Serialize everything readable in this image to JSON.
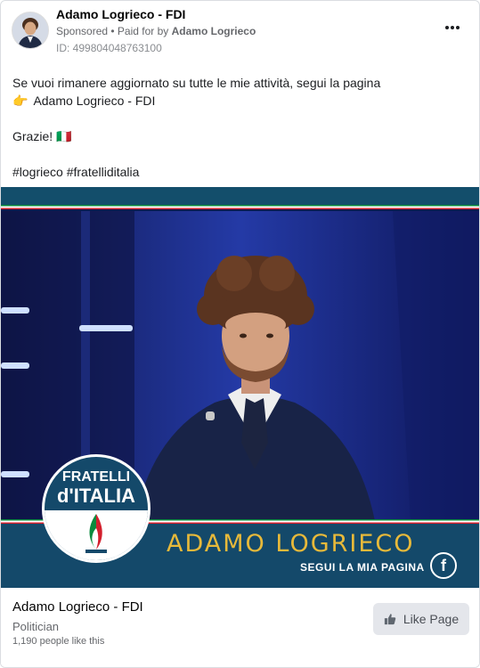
{
  "header": {
    "page_name": "Adamo Logrieco - FDI",
    "sponsored": "Sponsored",
    "paid_for_prefix": " • Paid for by ",
    "paid_by": "Adamo Logrieco",
    "ad_id": "ID: 499804048763100",
    "more_icon": "more-horizontal-icon"
  },
  "post": {
    "line1": "Se vuoi rimanere aggiornato su tutte le mie attività, segui la pagina",
    "line2_icon": "👉",
    "line2": "Adamo Logrieco - FDI",
    "thanks": "Grazie! 🇮🇹",
    "hashtags": "#logrieco #fratelliditalia"
  },
  "creative": {
    "logo_line1": "FRATELLI",
    "logo_line2": "d'ITALIA",
    "name": "ADAMO LOGRIECO",
    "cta": "SEGUI LA MIA PAGINA",
    "fb_icon": "f",
    "colors": {
      "navy": "#14496a",
      "gold": "#e7b93a",
      "green": "#0a8b3e",
      "red": "#d3202d"
    }
  },
  "footer": {
    "page_name": "Adamo Logrieco - FDI",
    "category": "Politician",
    "likes": "1,190 people like this",
    "like_button": "Like Page",
    "like_icon": "thumbs-up-icon"
  }
}
